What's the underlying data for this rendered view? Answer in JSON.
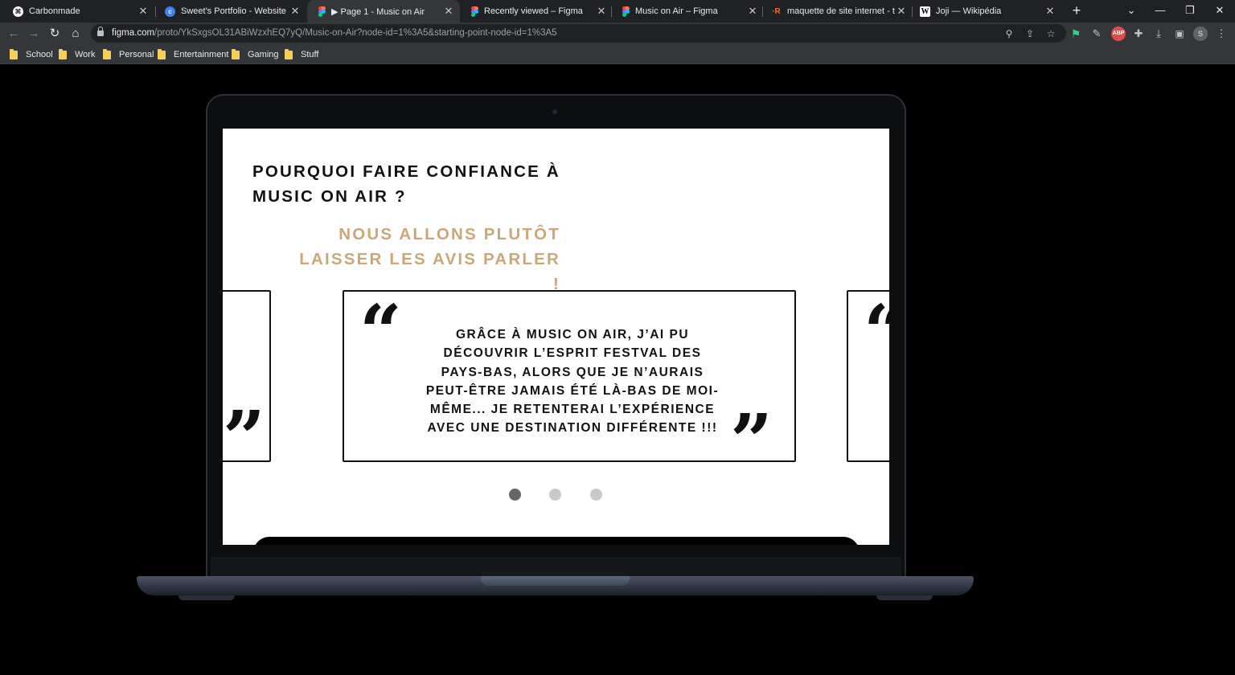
{
  "tabs": [
    {
      "title": "Carbonmade",
      "icon": "carbonmade-icon",
      "active": false
    },
    {
      "title": "Sweet's Portfolio - Website",
      "icon": "portfolio-icon",
      "active": false
    },
    {
      "title": "▶ Page 1 - Music on Air",
      "icon": "figma-icon",
      "active": true
    },
    {
      "title": "Recently viewed – Figma",
      "icon": "figma-icon",
      "active": false
    },
    {
      "title": "Music on Air – Figma",
      "icon": "figma-icon",
      "active": false
    },
    {
      "title": "maquette de site internet - trad",
      "icon": "reverso-icon",
      "active": false
    },
    {
      "title": "Joji — Wikipédia",
      "icon": "wikipedia-icon",
      "active": false
    }
  ],
  "address_bar": {
    "domain": "figma.com",
    "path": "/proto/YkSxgsOL31ABiWzxhEQ7yQ/Music-on-Air?node-id=1%3A5&starting-point-node-id=1%3A5"
  },
  "profile_initial": "S",
  "ext_abp": "ABP",
  "bookmarks": [
    "School",
    "Work",
    "Personal",
    "Entertainment",
    "Gaming",
    "Stuff"
  ],
  "page": {
    "heading_line1": "POURQUOI FAIRE CONFIANCE À",
    "heading_line2": "MUSIC ON AIR ?",
    "subheading_line1": "NOUS ALLONS PLUTÔT",
    "subheading_line2": "LAISSER LES AVIS PARLER !",
    "open_quote": "“",
    "close_quote": "”",
    "testimonial": "GRÂCE À MUSIC ON AIR, J’AI PU DÉCOUVRIR L’ESPRIT FESTVAL DES PAYS-BAS, ALORS QUE JE N’AURAIS PEUT-ÊTRE JAMAIS ÉTÉ LÀ-BAS DE MOI-MÊME... JE RETENTERAI L’EXPÉRIENCE AVEC UNE DESTINATION DIFFÉRENTE !!!",
    "carousel_dots": 3,
    "carousel_active_index": 0
  },
  "colors": {
    "accent_gold": "#c8a878",
    "tab_bar": "#202124",
    "toolbar": "#35363a"
  }
}
